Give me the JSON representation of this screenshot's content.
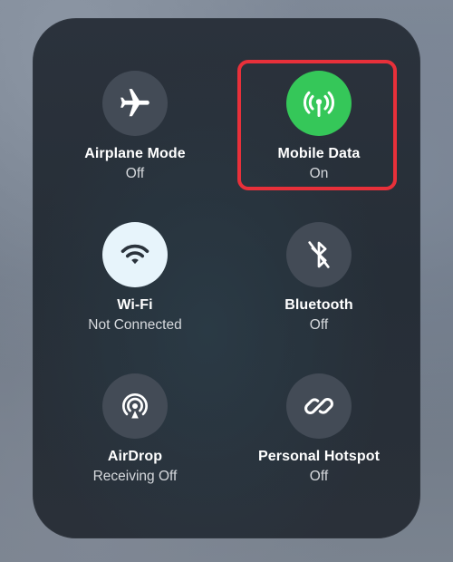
{
  "tiles": [
    {
      "id": "airplane",
      "label": "Airplane Mode",
      "status": "Off",
      "icon": "airplane-icon",
      "state": "off"
    },
    {
      "id": "mobile-data",
      "label": "Mobile Data",
      "status": "On",
      "icon": "antenna-icon",
      "state": "on"
    },
    {
      "id": "wifi",
      "label": "Wi-Fi",
      "status": "Not Connected",
      "icon": "wifi-icon",
      "state": "enabled"
    },
    {
      "id": "bluetooth",
      "label": "Bluetooth",
      "status": "Off",
      "icon": "bluetooth-off-icon",
      "state": "off"
    },
    {
      "id": "airdrop",
      "label": "AirDrop",
      "status": "Receiving Off",
      "icon": "airdrop-icon",
      "state": "off"
    },
    {
      "id": "hotspot",
      "label": "Personal Hotspot",
      "status": "Off",
      "icon": "hotspot-link-icon",
      "state": "off"
    }
  ],
  "colors": {
    "on": "#35c759",
    "enabled": "#e7f4fb",
    "off": "#434b56",
    "highlight": "#e8303a"
  }
}
